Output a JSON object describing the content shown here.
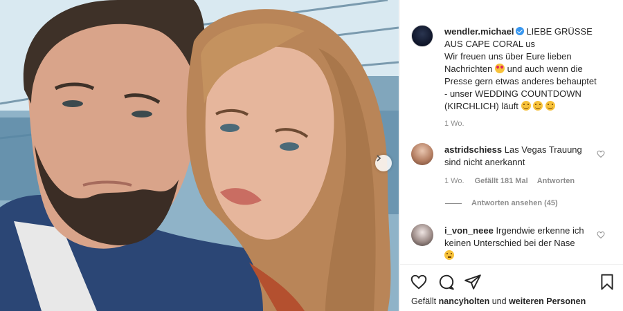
{
  "post": {
    "photo_alt": "Selfie of a man with a beard and a young woman with long hair"
  },
  "caption": {
    "username": "wendler.michael",
    "text_line1": "LIEBE GRÜSSE",
    "text_line2": "AUS CAPE CORAL us",
    "text_line3": "Wir freuen uns über Eure lieben",
    "text_line4": "Nachrichten",
    "text_line4b": "und auch wenn die",
    "text_line5": "Presse gern etwas anderes behauptet",
    "text_line6": "- unser WEDDING COUNTDOWN",
    "text_line7": "(KIRCHLICH) läuft",
    "time": "1 Wo."
  },
  "comments": [
    {
      "username": "astridschiess",
      "text_a": "Las Vegas Trauung",
      "text_b": "sind nicht anerkannt",
      "time": "1 Wo.",
      "likes": "Gefällt 181 Mal",
      "reply": "Antworten"
    },
    {
      "username": "i_von_neee",
      "text_a": "Irgendwie erkenne ich",
      "text_b": "keinen Unterschied bei der Nase"
    }
  ],
  "view_replies": "Antworten ansehen (45)",
  "liked_by": {
    "prefix": "Gefällt",
    "user": "nancyholten",
    "middle": "und",
    "others": "weiteren Personen"
  },
  "icons": {
    "like": "heart-icon",
    "comment": "comment-icon",
    "share": "share-icon",
    "save": "bookmark-icon",
    "next": "chevron-right-icon",
    "verified": "verified-badge-icon"
  },
  "colors": {
    "verified": "#3897f0",
    "meta_text": "#8e8e8e",
    "text": "#262626"
  }
}
